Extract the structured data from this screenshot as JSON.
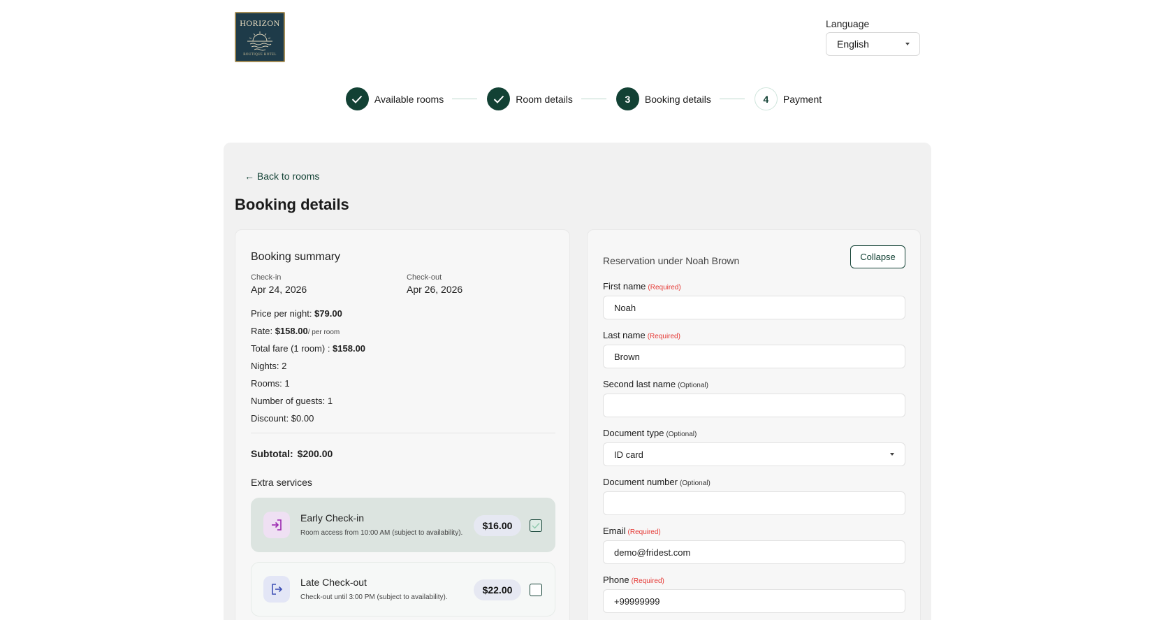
{
  "logo": {
    "title": "HORIZON",
    "subtitle": "BOUTIQUE HOTEL"
  },
  "language": {
    "label": "Language",
    "selected": "English"
  },
  "steps": [
    {
      "label": "Available rooms",
      "status": "done",
      "number": "1"
    },
    {
      "label": "Room details",
      "status": "done",
      "number": "2"
    },
    {
      "label": "Booking details",
      "status": "current",
      "number": "3"
    },
    {
      "label": "Payment",
      "status": "pending",
      "number": "4"
    }
  ],
  "back_link": "← Back to rooms",
  "page_title": "Booking details",
  "summary": {
    "title": "Booking summary",
    "checkin_label": "Check-in",
    "checkin_value": "Apr 24, 2026",
    "checkout_label": "Check-out",
    "checkout_value": "Apr 26, 2026",
    "price_per_night_label": "Price per night: ",
    "price_per_night_value": "$79.00",
    "rate_label": "Rate: ",
    "rate_value": "$158.00",
    "rate_unit": "/ per room",
    "total_fare_label": "Total fare (1 room) : ",
    "total_fare_value": "$158.00",
    "nights": "Nights: 2",
    "rooms": "Rooms: 1",
    "guests": "Number of guests: 1",
    "discount": "Discount: $0.00",
    "subtotal_label": "Subtotal:",
    "subtotal_value": "$200.00",
    "extras_title": "Extra services"
  },
  "extras": [
    {
      "name": "Early Check-in",
      "description": "Room access from 10:00 AM (subject to availability).",
      "price": "$16.00",
      "checked": true,
      "icon": "login-icon"
    },
    {
      "name": "Late Check-out",
      "description": "Check-out until 3:00 PM (subject to availability).",
      "price": "$22.00",
      "checked": false,
      "icon": "logout-icon"
    }
  ],
  "form": {
    "title": "Reservation under Noah Brown",
    "collapse_label": "Collapse",
    "required_tag": "(Required)",
    "optional_tag": "(Optional)",
    "first_name": {
      "label": "First name",
      "value": "Noah"
    },
    "last_name": {
      "label": "Last name",
      "value": "Brown"
    },
    "second_last_name": {
      "label": "Second last name",
      "value": ""
    },
    "document_type": {
      "label": "Document type",
      "value": "ID card"
    },
    "document_number": {
      "label": "Document number",
      "value": ""
    },
    "email": {
      "label": "Email",
      "value": "demo@fridest.com"
    },
    "phone": {
      "label": "Phone",
      "value": "+99999999"
    }
  },
  "colors": {
    "primary": "#124134",
    "required": "#e53935",
    "panel": "#f1f1f1"
  }
}
